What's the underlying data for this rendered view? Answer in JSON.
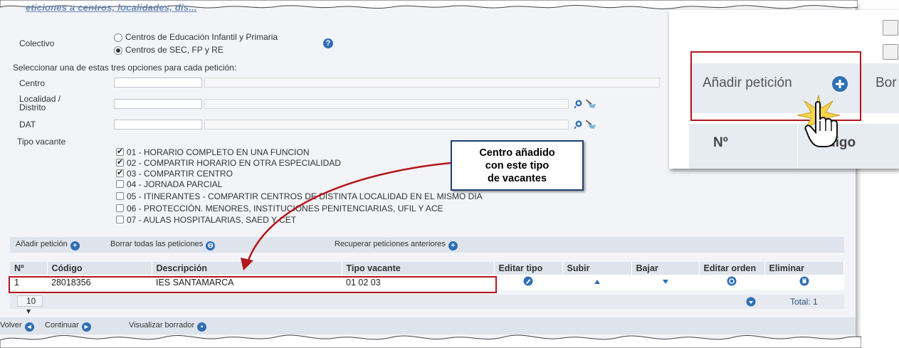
{
  "section": {
    "title": "eticiones a centros, localidades, dis..."
  },
  "colectivo": {
    "label": "Colectivo",
    "options": [
      "Centros de Educación Infantil y Primaria",
      "Centros de SEC, FP y RE"
    ],
    "selected_index": 1,
    "help_icon": "question-icon"
  },
  "instructions": "Seleccionar una de estas tres opciones para cada petición:",
  "fields": {
    "centro": "Centro",
    "localidad": "Localidad /\nDistrito",
    "dat": "DAT",
    "search_icon": "magnifier-icon",
    "clear_icon": "broom-icon"
  },
  "tipo_vacante": {
    "label": "Tipo vacante",
    "items": [
      {
        "label": "01 - HORARIO COMPLETO EN UNA FUNCION",
        "checked": true
      },
      {
        "label": "02 - COMPARTIR HORARIO EN OTRA ESPECIALIDAD",
        "checked": true
      },
      {
        "label": "03 - COMPARTIR CENTRO",
        "checked": true
      },
      {
        "label": "04 - JORNADA PARCIAL",
        "checked": false
      },
      {
        "label": "05 - ITINERANTES - COMPARTIR CENTROS DE DISTINTA LOCALIDAD EN EL MISMO DIA",
        "checked": false
      },
      {
        "label": "06 - PROTECCIÓN. MENORES, INSTITUCIONES PENITENCIARIAS, UFIL Y ACE",
        "checked": false
      },
      {
        "label": "07 - AULAS HOSPITALARIAS, SAED Y CET",
        "checked": false
      }
    ]
  },
  "toolbar": {
    "add": "Añadir petición",
    "delete_all": "Borrar todas las peticiones",
    "recover": "Recuperar peticiones anteriores"
  },
  "table": {
    "headers": [
      "Nº",
      "Código",
      "Descripción",
      "Tipo vacante",
      "Editar tipo",
      "Subir",
      "Bajar",
      "Editar orden",
      "Eliminar"
    ],
    "rows": [
      {
        "num": "1",
        "codigo": "28018356",
        "descripcion": "IES SANTAMARCA",
        "tipo": "01 02 03"
      }
    ]
  },
  "pager": {
    "page_size": "10",
    "total": "Total: 1"
  },
  "bottom": {
    "back": "Volver",
    "continue": "Continuar",
    "draft": "Visualizar borrador"
  },
  "callout": {
    "line1": "Centro añadido",
    "line2": "con este tipo",
    "line3": "de vacantes"
  },
  "zoom": {
    "add": "Añadir petición",
    "partial_button": "Bor",
    "col_num": "Nº",
    "col_code": "digo"
  },
  "colors": {
    "accent": "#2f6fb5",
    "highlight": "#b3161b",
    "callout_border": "#1f3f77"
  }
}
